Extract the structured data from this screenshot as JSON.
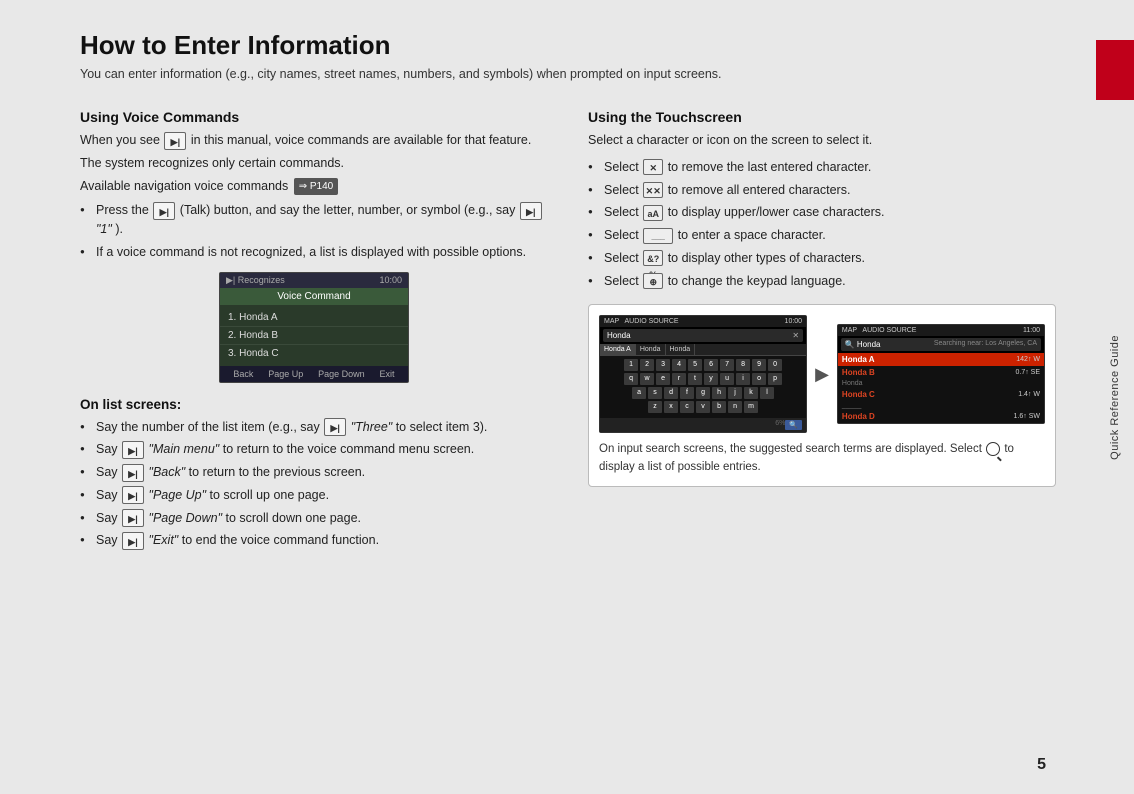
{
  "page": {
    "title": "How to Enter Information",
    "subtitle": "You can enter information (e.g., city names, street names, numbers, and symbols) when prompted on input screens.",
    "page_number": "5"
  },
  "side_label": "Quick Reference Guide",
  "left_column": {
    "voice_heading": "Using Voice Commands",
    "voice_intro": "When you see",
    "voice_intro2": "in this manual, voice commands are available for that feature.",
    "voice_recognizes": "The system recognizes only certain commands.",
    "voice_available": "Available navigation voice commands",
    "voice_p140": "P140",
    "voice_bullet1_prefix": "Press the",
    "voice_bullet1_suffix": "(Talk) button, and say the letter, number, or symbol (e.g., say",
    "voice_bullet1_quote": "\"1\"",
    "voice_bullet1_end": ").",
    "voice_bullet2": "If a voice command is not recognized, a list is displayed with possible options.",
    "vc_screenshot": {
      "time": "10:00",
      "header": "Voice Command",
      "items": [
        "1. Honda A",
        "2. Honda B",
        "3. Honda C"
      ],
      "buttons": [
        "Back",
        "Page Up",
        "Page Down",
        "Exit"
      ]
    },
    "list_screens_heading": "On list screens:",
    "list_bullets": [
      {
        "prefix": "Say the number of the list item (e.g., say",
        "quote": "\"Three\"",
        "suffix": "to select item 3)."
      },
      {
        "prefix": "Say",
        "quote": "\"Main menu\"",
        "suffix": "to return to the voice command menu screen."
      },
      {
        "prefix": "Say",
        "quote": "\"Back\"",
        "suffix": "to return to the previous screen."
      },
      {
        "prefix": "Say",
        "quote": "\"Page Up\"",
        "suffix": "to scroll up one page."
      },
      {
        "prefix": "Say",
        "quote": "\"Page Down\"",
        "suffix": "to scroll down one page."
      },
      {
        "prefix": "Say",
        "quote": "\"Exit\"",
        "suffix": "to end the voice command function."
      }
    ]
  },
  "right_column": {
    "touchscreen_heading": "Using the Touchscreen",
    "touchscreen_intro": "Select a character or icon on the screen to select it.",
    "touchscreen_bullets": [
      {
        "prefix": "Select",
        "icon": "backspace",
        "suffix": "to remove the last entered character."
      },
      {
        "prefix": "Select",
        "icon": "clear-all",
        "suffix": "to remove all entered characters."
      },
      {
        "prefix": "Select",
        "icon": "case",
        "suffix": "to display upper/lower case characters."
      },
      {
        "prefix": "Select",
        "icon": "space",
        "suffix": "to enter a space character."
      },
      {
        "prefix": "Select",
        "icon": "symbols",
        "suffix": "to display other types of characters."
      },
      {
        "prefix": "Select",
        "icon": "language",
        "suffix": "to change the keypad language."
      }
    ],
    "screenshot": {
      "left_screen": {
        "tabs": [
          "MAP",
          "AUDIO SOURCE"
        ],
        "time": "10:00",
        "search_text": "Honda",
        "tab_items": [
          "Honda A",
          "Honda",
          "Honda"
        ],
        "keys_row1": [
          "1",
          "2",
          "3",
          "4",
          "5",
          "6",
          "7",
          "8",
          "9",
          "0"
        ],
        "keys_row2": [
          "q",
          "w",
          "e",
          "r",
          "t",
          "y",
          "u",
          "i",
          "o",
          "p"
        ],
        "keys_row3": [
          "a",
          "s",
          "d",
          "f",
          "g",
          "h",
          "j",
          "k",
          "l"
        ],
        "keys_row4": [
          "z",
          "x",
          "c",
          "v",
          "b",
          "n",
          "m"
        ]
      },
      "right_screen": {
        "tabs": [
          "MAP",
          "AUDIO SOURCE"
        ],
        "time": "11:00",
        "search_text": "Honda",
        "subtitle": "Searching near: Los Angeles, CA",
        "results": [
          {
            "name": "Honda A",
            "dist": "142↑ W",
            "highlight": true
          },
          {
            "name": "Honda B",
            "dist": "0.7↑ SE"
          },
          {
            "name": "Honda",
            "dist": ""
          },
          {
            "name": "Honda C",
            "dist": "1.4↑ W"
          },
          {
            "name": "",
            "dist": ""
          },
          {
            "name": "Honda D",
            "dist": "1.6↑ SW"
          }
        ]
      },
      "caption": "On input search screens, the suggested search terms are displayed. Select",
      "caption2": "to display a list of possible entries."
    }
  }
}
